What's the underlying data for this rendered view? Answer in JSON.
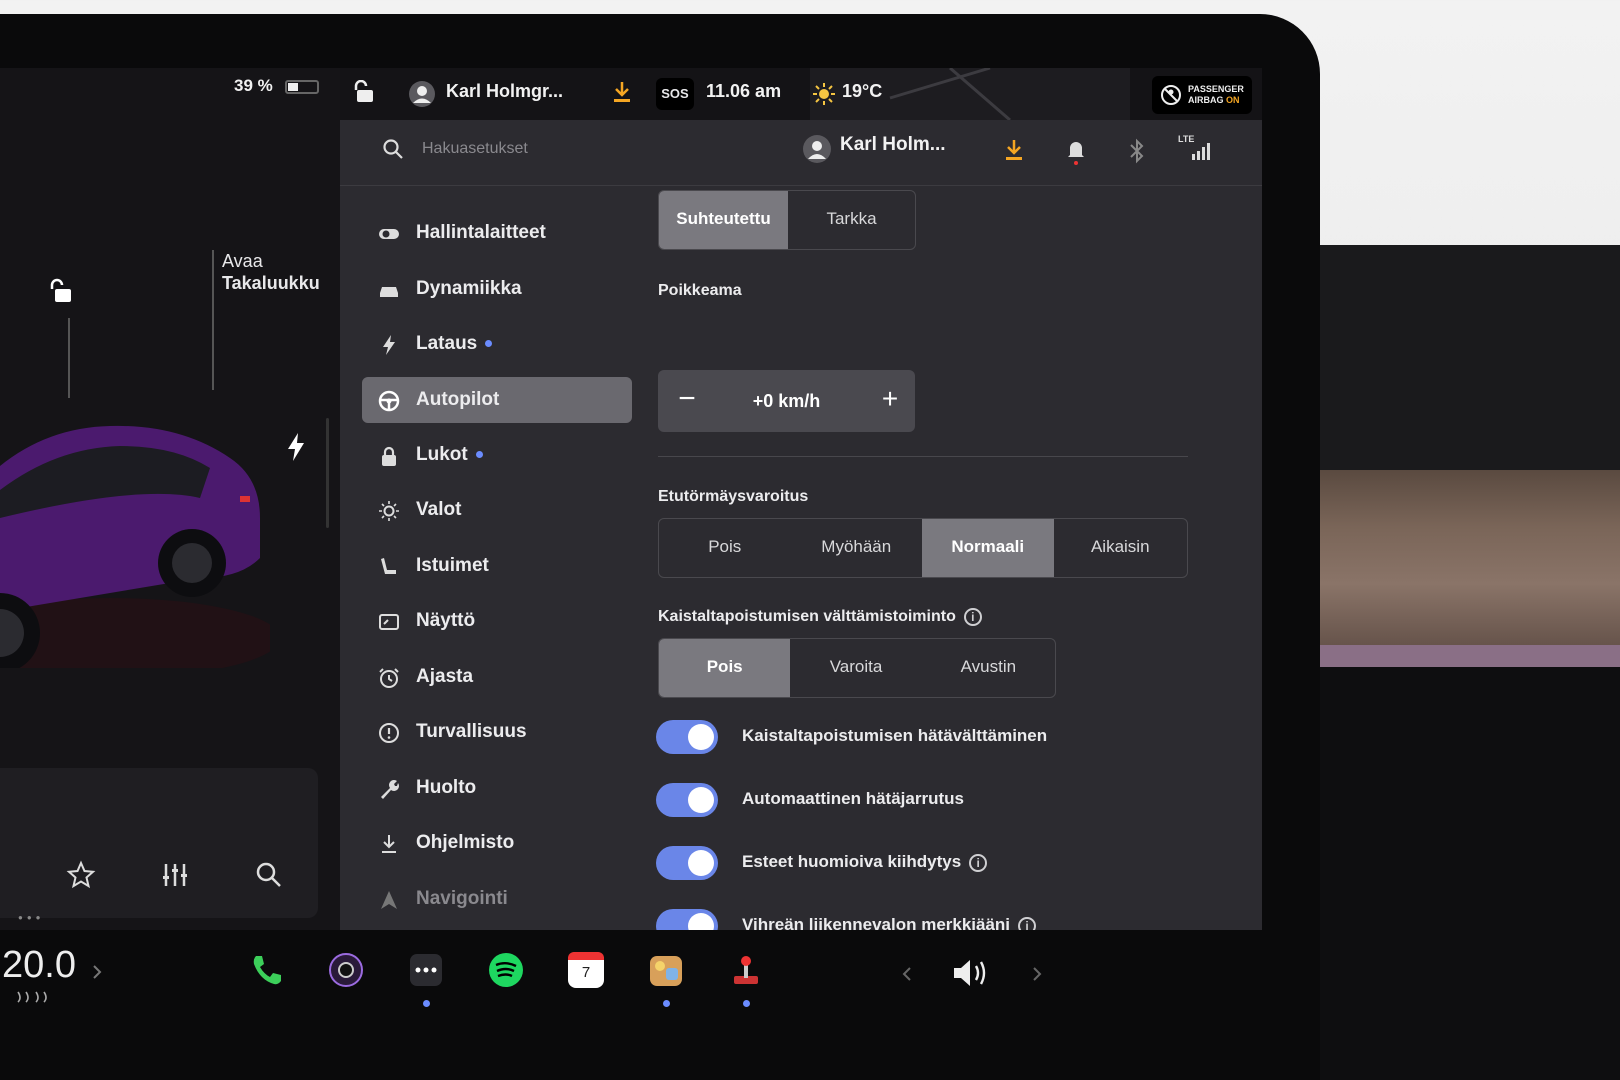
{
  "status_bar": {
    "battery": "39 %",
    "profile_name": "Karl Holmgr...",
    "sos": "SOS",
    "time": "11.06 am",
    "temperature": "19°C",
    "airbag_line1": "PASSENGER",
    "airbag_line2": "AIRBAG",
    "airbag_state": "ON"
  },
  "car_panel": {
    "trunk_label_1": "Avaa",
    "trunk_label_2": "Takaluukku",
    "temperature": "20.0"
  },
  "settings_bar": {
    "search_placeholder": "Hakuasetukset",
    "profile_name": "Karl Holm...",
    "lte": "LTE"
  },
  "nav": {
    "items": [
      {
        "label": "Hallintalaitteet"
      },
      {
        "label": "Dynamiikka"
      },
      {
        "label": "Lataus"
      },
      {
        "label": "Autopilot"
      },
      {
        "label": "Lukot"
      },
      {
        "label": "Valot"
      },
      {
        "label": "Istuimet"
      },
      {
        "label": "Näyttö"
      },
      {
        "label": "Ajasta"
      },
      {
        "label": "Turvallisuus"
      },
      {
        "label": "Huolto"
      },
      {
        "label": "Ohjelmisto"
      },
      {
        "label": "Navigointi"
      }
    ]
  },
  "content": {
    "speed_mode": {
      "options": [
        "Suhteutettu",
        "Tarkka"
      ],
      "selected": "Suhteutettu"
    },
    "offset": {
      "label": "Poikkeama",
      "value": "+0 km/h",
      "minus": "−",
      "plus": "+"
    },
    "forward_collision": {
      "label": "Etutörmäysvaroitus",
      "options": [
        "Pois",
        "Myöhään",
        "Normaali",
        "Aikaisin"
      ],
      "selected": "Normaali"
    },
    "lane_departure": {
      "label": "Kaistaltapoistumisen välttämistoiminto",
      "options": [
        "Pois",
        "Varoita",
        "Avustin"
      ],
      "selected": "Pois"
    },
    "toggles": [
      {
        "label": "Kaistaltapoistumisen hätävälttäminen",
        "on": true,
        "info": false
      },
      {
        "label": "Automaattinen hätäjarrutus",
        "on": true,
        "info": false
      },
      {
        "label": "Esteet huomioiva kiihdytys",
        "on": true,
        "info": true
      },
      {
        "label": "Vihreän liikennevalon merkkiääni",
        "on": true,
        "info": true
      }
    ]
  },
  "dock": {
    "calendar_day": "7"
  },
  "colors": {
    "accent": "#6a86e8",
    "selected_segment": "#7a797f",
    "download_icon": "#f5a623"
  }
}
